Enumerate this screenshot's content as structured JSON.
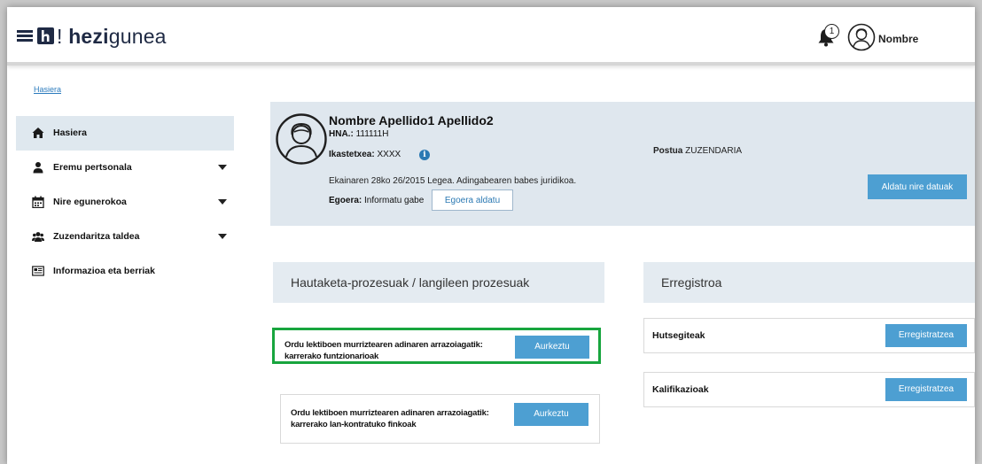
{
  "header": {
    "app_name_bold": "hezi",
    "app_name_rest": "gunea",
    "logo_exclaim": "!",
    "notification_count": "1",
    "user_name": "Nombre"
  },
  "breadcrumb": "Hasiera",
  "sidebar": {
    "items": [
      {
        "label": "Hasiera",
        "icon": "home-icon",
        "expandable": false
      },
      {
        "label": "Eremu pertsonala",
        "icon": "user-icon",
        "expandable": true
      },
      {
        "label": "Nire egunerokoa",
        "icon": "calendar-icon",
        "expandable": true
      },
      {
        "label": "Zuzendaritza taldea",
        "icon": "group-icon",
        "expandable": true
      },
      {
        "label": "Informazioa eta berriak",
        "icon": "news-icon",
        "expandable": false
      }
    ]
  },
  "profile": {
    "name": "Nombre Apellido1 Apellido2",
    "hna_label": "HNA.:",
    "hna_value": "111111H",
    "school_label": "Ikastetxea:",
    "school_value": "XXXX",
    "law_text": "Ekainaren 28ko 26/2015 Legea. Adingabearen babes juridikoa.",
    "status_label": "Egoera:",
    "status_value": "Informatu gabe",
    "status_button": "Egoera aldatu",
    "post_label": "Postua",
    "post_value": "ZUZENDARIA",
    "edit_button": "Aldatu nire datuak"
  },
  "processes": {
    "title": "Hautaketa-prozesuak / langileen prozesuak",
    "items": [
      {
        "line1": "Ordu lektiboen murriztearen adinaren arrazoiagatik:",
        "line2": "karrerako funtzionarioak",
        "button": "Aurkeztu"
      },
      {
        "line1": "Ordu lektiboen murriztearen adinaren arrazoiagatik:",
        "line2": "karrerako lan-kontratuko finkoak",
        "button": "Aurkeztu"
      }
    ]
  },
  "registry": {
    "title": "Erregistroa",
    "items": [
      {
        "label": "Hutsegiteak",
        "button": "Erregistratzea"
      },
      {
        "label": "Kalifikazioak",
        "button": "Erregistratzea"
      }
    ]
  },
  "colors": {
    "accent": "#4d9fd2",
    "navy": "#1f2a44",
    "highlight": "#18a53e",
    "panel": "#dfe7ee"
  }
}
